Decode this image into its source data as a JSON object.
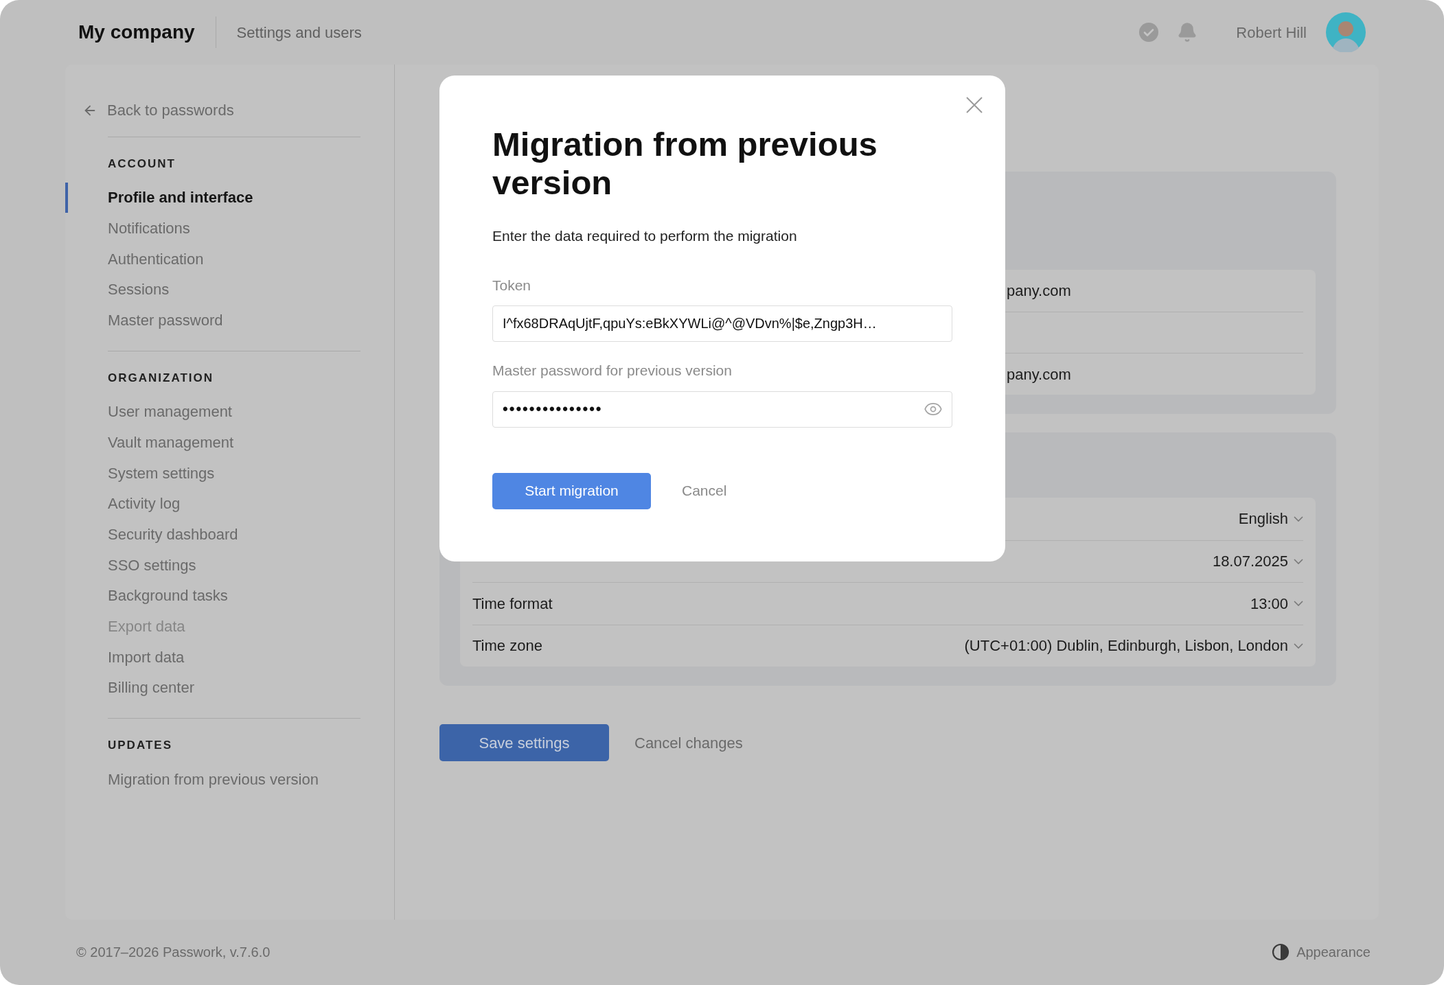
{
  "header": {
    "logo": "My company",
    "section": "Settings and users",
    "user_name": "Robert Hill"
  },
  "sidebar": {
    "back_link": "Back to passwords",
    "groups": [
      {
        "heading": "ACCOUNT",
        "items": [
          {
            "label": "Profile and interface",
            "selected": true,
            "disabled": false
          },
          {
            "label": "Notifications",
            "selected": false,
            "disabled": false
          },
          {
            "label": "Authentication",
            "selected": false,
            "disabled": false
          },
          {
            "label": "Sessions",
            "selected": false,
            "disabled": false
          },
          {
            "label": "Master password",
            "selected": false,
            "disabled": false
          }
        ]
      },
      {
        "heading": "ORGANIZATION",
        "items": [
          {
            "label": "User management",
            "selected": false,
            "disabled": false
          },
          {
            "label": "Vault management",
            "selected": false,
            "disabled": false
          },
          {
            "label": "System settings",
            "selected": false,
            "disabled": false
          },
          {
            "label": "Activity log",
            "selected": false,
            "disabled": false
          },
          {
            "label": "Security dashboard",
            "selected": false,
            "disabled": false
          },
          {
            "label": "SSO settings",
            "selected": false,
            "disabled": false
          },
          {
            "label": "Background tasks",
            "selected": false,
            "disabled": false
          },
          {
            "label": "Export data",
            "selected": false,
            "disabled": true
          },
          {
            "label": "Import data",
            "selected": false,
            "disabled": false
          },
          {
            "label": "Billing center",
            "selected": false,
            "disabled": false
          }
        ]
      },
      {
        "heading": "UPDATES",
        "items": [
          {
            "label": "Migration from previous version",
            "selected": false,
            "disabled": false
          }
        ]
      }
    ]
  },
  "content": {
    "panels": [
      {
        "rows": [
          {
            "value": "pany.com"
          },
          {},
          {
            "value": "pany.com"
          }
        ]
      },
      {
        "rows": [
          {
            "value": "English"
          },
          {
            "value": "18.07.2025"
          },
          {
            "label": "Time format",
            "value": "13:00"
          },
          {
            "label": "Time zone",
            "value": "(UTC+01:00) Dublin, Edinburgh, Lisbon, London"
          }
        ]
      }
    ],
    "save_button": "Save settings",
    "cancel_button": "Cancel changes"
  },
  "footer": {
    "copyright": "© 2017–2026 Passwork, v.7.6.0",
    "appearance": "Appearance"
  },
  "dialog": {
    "title": "Migration from previous version",
    "description": "Enter the data required to perform the migration",
    "fields": [
      {
        "kind": "text",
        "label": "Token",
        "value": "I^fx68DRAqUjtF,qpuYs:eBkXYWLi@^@VDvn%|$e,Zngp3H…"
      },
      {
        "kind": "password",
        "label": "Master password for previous version",
        "value": "•••••••••••••••"
      }
    ],
    "primary_button": "Start migration",
    "cancel_button": "Cancel"
  }
}
